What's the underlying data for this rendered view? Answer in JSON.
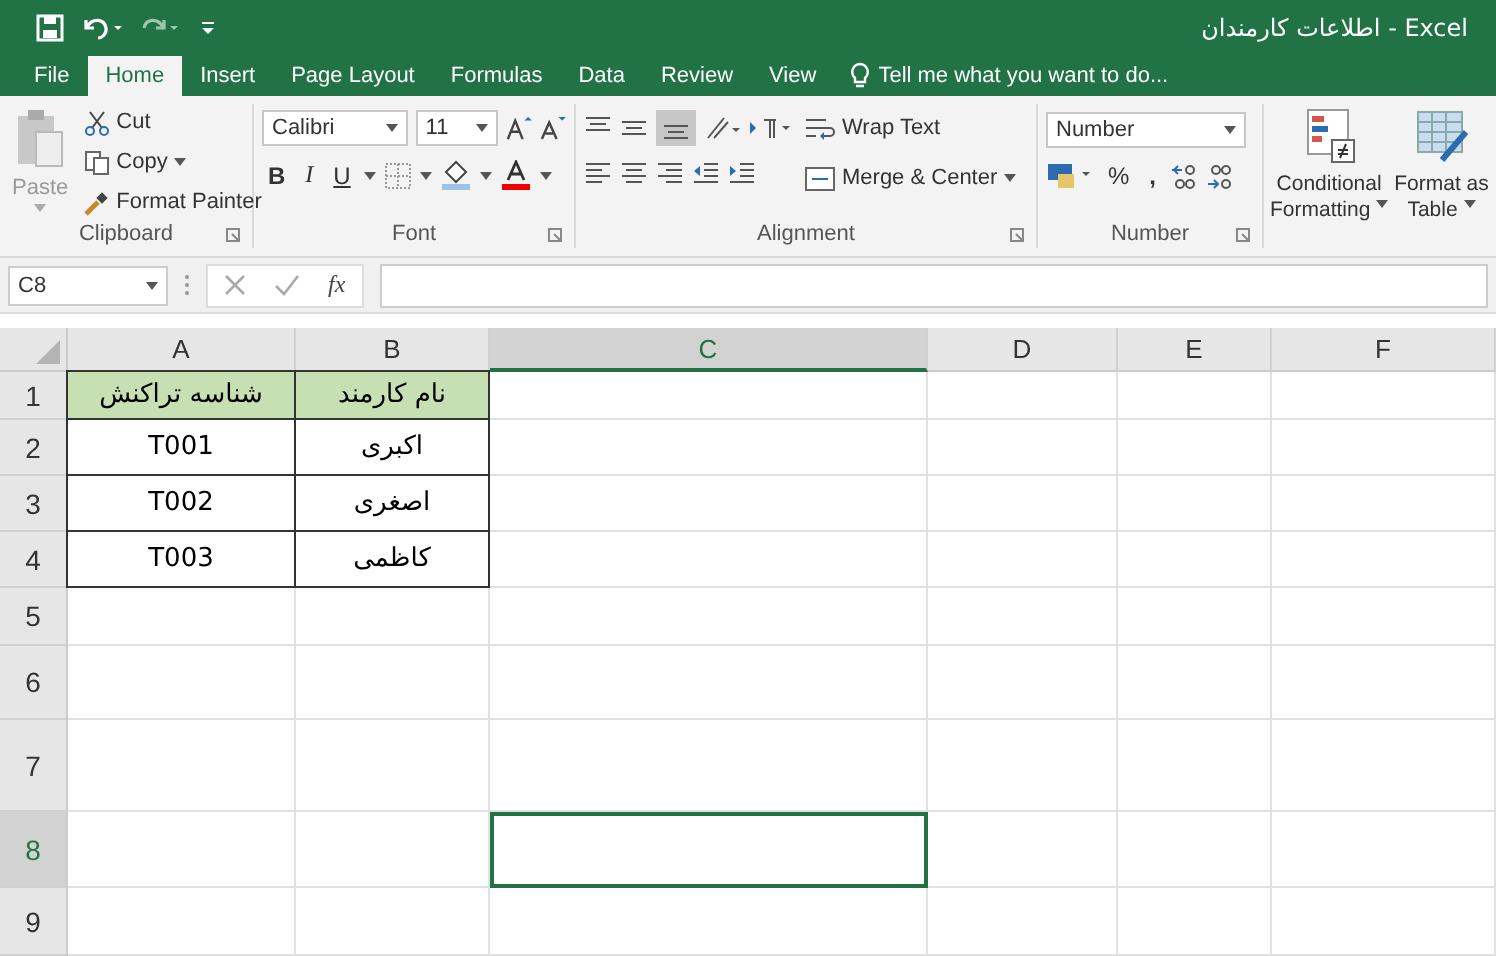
{
  "window": {
    "title": "اطلاعات کارمندان - Excel"
  },
  "tabs": [
    {
      "label": "File",
      "selected": false
    },
    {
      "label": "Home",
      "selected": true
    },
    {
      "label": "Insert",
      "selected": false
    },
    {
      "label": "Page Layout",
      "selected": false
    },
    {
      "label": "Formulas",
      "selected": false
    },
    {
      "label": "Data",
      "selected": false
    },
    {
      "label": "Review",
      "selected": false
    },
    {
      "label": "View",
      "selected": false
    }
  ],
  "tell_me": {
    "placeholder": "Tell me what you want to do..."
  },
  "ribbon": {
    "clipboard": {
      "paste": "Paste",
      "cut": "Cut",
      "copy": "Copy",
      "format_painter": "Format Painter",
      "label": "Clipboard"
    },
    "font": {
      "font_name": "Calibri",
      "font_size": "11",
      "bold": "B",
      "italic": "I",
      "underline": "U",
      "label": "Font"
    },
    "alignment": {
      "wrap_text": "Wrap Text",
      "merge_center": "Merge & Center",
      "label": "Alignment"
    },
    "number": {
      "format": "Number",
      "percent": "%",
      "comma": ",",
      "label": "Number"
    },
    "styles": {
      "conditional_formatting": [
        "Conditional",
        "Formatting"
      ],
      "format_as_table": [
        "Format as",
        "Table"
      ]
    }
  },
  "formula_bar": {
    "name_box": "C8",
    "fx": "fx"
  },
  "sheet": {
    "columns": [
      {
        "label": "A",
        "selected": false
      },
      {
        "label": "B",
        "selected": false
      },
      {
        "label": "C",
        "selected": true
      },
      {
        "label": "D",
        "selected": false
      },
      {
        "label": "E",
        "selected": false
      },
      {
        "label": "F",
        "selected": false
      }
    ],
    "rows": [
      {
        "label": "1",
        "selected": false,
        "cells": [
          {
            "text": "شناسه تراکنش",
            "kind": "header"
          },
          {
            "text": "نام کارمند",
            "kind": "header"
          }
        ]
      },
      {
        "label": "2",
        "selected": false,
        "cells": [
          {
            "text": "T001",
            "kind": "data"
          },
          {
            "text": "اکبری",
            "kind": "data"
          }
        ]
      },
      {
        "label": "3",
        "selected": false,
        "cells": [
          {
            "text": "T002",
            "kind": "data"
          },
          {
            "text": "اصغری",
            "kind": "data"
          }
        ]
      },
      {
        "label": "4",
        "selected": false,
        "cells": [
          {
            "text": "T003",
            "kind": "data"
          },
          {
            "text": "کاظمی",
            "kind": "data"
          }
        ]
      },
      {
        "label": "5",
        "selected": false,
        "cells": []
      },
      {
        "label": "6",
        "selected": false,
        "cells": []
      },
      {
        "label": "7",
        "selected": false,
        "cells": []
      },
      {
        "label": "8",
        "selected": true,
        "cells": []
      },
      {
        "label": "9",
        "selected": false,
        "cells": []
      }
    ]
  }
}
